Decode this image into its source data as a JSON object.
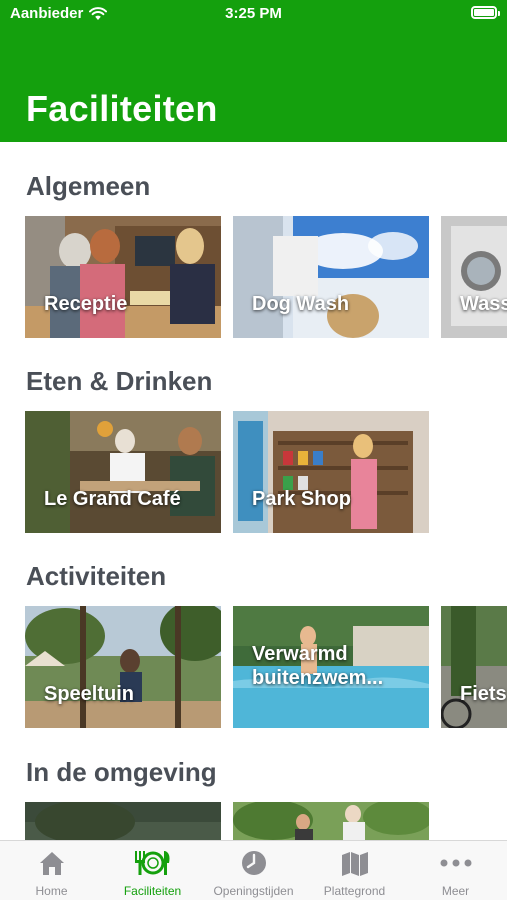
{
  "status_bar": {
    "carrier": "Aanbieder",
    "time": "3:25 PM"
  },
  "header": {
    "title": "Faciliteiten"
  },
  "sections": [
    {
      "title": "Algemeen",
      "cards": [
        {
          "label": "Receptie"
        },
        {
          "label": "Dog Wash"
        },
        {
          "label": "Wass"
        }
      ]
    },
    {
      "title": "Eten & Drinken",
      "cards": [
        {
          "label": "Le Grand Café"
        },
        {
          "label": "Park Shop"
        }
      ]
    },
    {
      "title": "Activiteiten",
      "cards": [
        {
          "label": "Speeltuin"
        },
        {
          "label": "Verwarmd buitenzwem..."
        },
        {
          "label": "Fiets"
        }
      ]
    },
    {
      "title": "In de omgeving",
      "cards": [
        {
          "label": ""
        },
        {
          "label": ""
        }
      ]
    }
  ],
  "tabbar": {
    "items": [
      {
        "label": "Home",
        "icon": "home-icon"
      },
      {
        "label": "Faciliteiten",
        "icon": "cutlery-icon",
        "active": true
      },
      {
        "label": "Openingstijden",
        "icon": "clock-icon"
      },
      {
        "label": "Plattegrond",
        "icon": "map-icon"
      },
      {
        "label": "Meer",
        "icon": "more-icon"
      }
    ]
  },
  "colors": {
    "brand": "#14a00d",
    "section_title": "#4a4f57",
    "tab_inactive": "#8e8e93"
  }
}
